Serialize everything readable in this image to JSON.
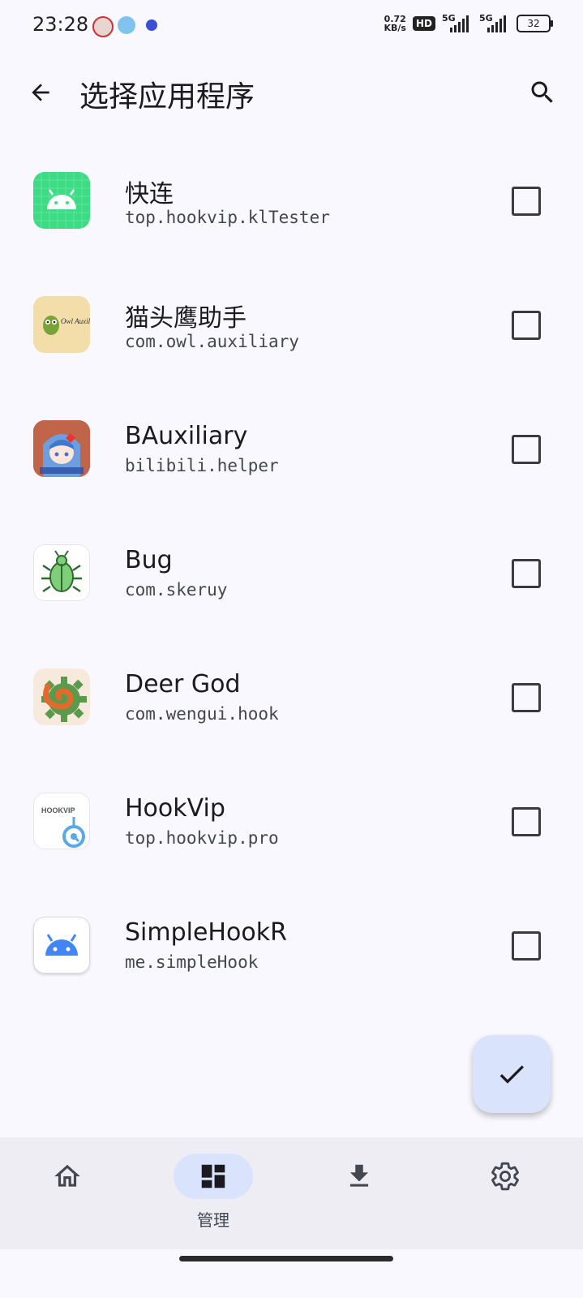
{
  "status_bar": {
    "time": "23:28",
    "net_speed_value": "0.72",
    "net_speed_unit": "KB/s",
    "hd_badge": "HD",
    "sim1_label": "5G",
    "sim2_label": "5G",
    "battery": "32"
  },
  "header": {
    "title": "选择应用程序",
    "back_icon": "arrow-back-icon",
    "search_icon": "search-icon"
  },
  "apps": [
    {
      "name": "快连",
      "package": "top.hookvip.klTester",
      "checked": false
    },
    {
      "name": "猫头鹰助手",
      "package": "com.owl.auxiliary",
      "checked": false,
      "icon_text": "Owl Auxiliary"
    },
    {
      "name": "BAuxiliary",
      "package": "bilibili.helper",
      "checked": false
    },
    {
      "name": "Bug",
      "package": "com.skeruy",
      "checked": false
    },
    {
      "name": "Deer God",
      "package": "com.wengui.hook",
      "checked": false
    },
    {
      "name": "HookVip",
      "package": "top.hookvip.pro",
      "checked": false,
      "icon_text": "HOOKVIP"
    },
    {
      "name": "SimpleHookR",
      "package": "me.simpleHook",
      "checked": false
    }
  ],
  "fab": {
    "icon": "check-icon"
  },
  "bottom_nav": {
    "items": [
      {
        "icon": "home-icon",
        "label": "",
        "active": false
      },
      {
        "icon": "dashboard-icon",
        "label": "管理",
        "active": true
      },
      {
        "icon": "download-icon",
        "label": "",
        "active": false
      },
      {
        "icon": "settings-icon",
        "label": "",
        "active": false
      }
    ]
  },
  "colors": {
    "background": "#f9f8fe",
    "accent_container": "#d9e3fc",
    "nav_background": "#eeedf4"
  }
}
